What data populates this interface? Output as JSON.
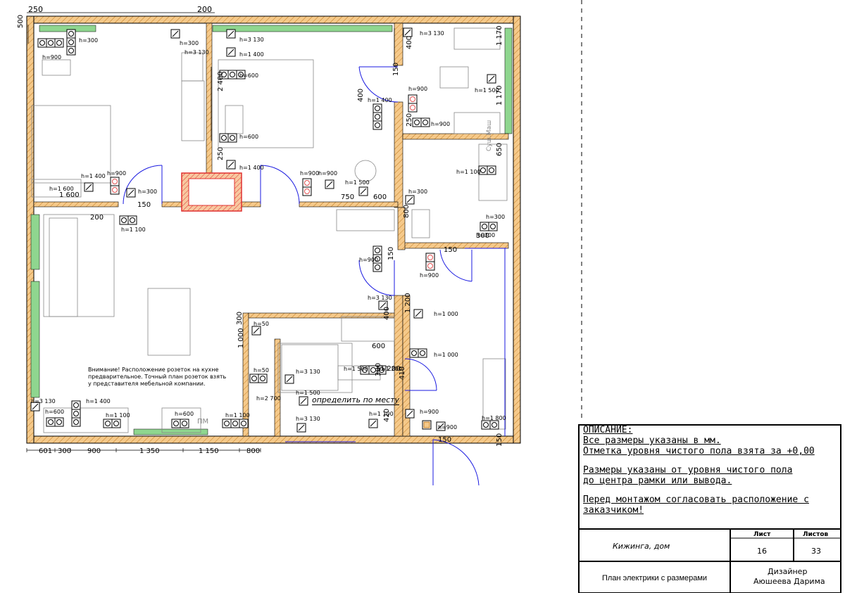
{
  "top_dims": [
    "250",
    "200"
  ],
  "bottom_dims": [
    "601",
    "300",
    "900",
    "1 350",
    "1 150",
    "800"
  ],
  "left_dims": [
    "500"
  ],
  "room_dims": [
    "2 400",
    "400",
    "400",
    "150",
    "250",
    "250",
    "1 170",
    "1 170",
    "650",
    "800",
    "150",
    "300",
    "150",
    "1 200",
    "400",
    "300",
    "1 000",
    "300",
    "410",
    "420",
    "150",
    "150",
    "1 600",
    "200",
    "150",
    "750",
    "600",
    "600",
    "1 200"
  ],
  "heights": [
    "h=300",
    "h=900",
    "h=300",
    "h=3 130",
    "h=3 130",
    "h=1 400",
    "h=600",
    "h=600",
    "h=1 400",
    "h=3 130",
    "h=900",
    "h=1 500",
    "h=1 400",
    "h=900",
    "h=1 100",
    "h=300",
    "h=300",
    "h=1 400",
    "h=900",
    "h=1 600",
    "h=300",
    "h=1 100",
    "h=900",
    "h=900",
    "h=1 500",
    "h=300",
    "h=900",
    "h=900",
    "h=3 130",
    "h=1 000",
    "h=1 000",
    "h=50",
    "h=50",
    "h=3 130",
    "h=2 700",
    "h=1 500",
    "h=1 500",
    "h=1 200",
    "h=3 130",
    "h=3 130",
    "h=1 100",
    "h=900",
    "h=900",
    "h=600",
    "h=1 400",
    "h=1 100",
    "h=600",
    "h=1 100",
    "h=1 800"
  ],
  "kitchen_note": [
    "Внимание! Расположение розеток на кухне",
    "предварительное. Точный план розеток взять",
    "у представителя мебельной компании."
  ],
  "determine_label": "определить по месту",
  "pm_label": "ПМ",
  "dryer_label": "Суш.Маш",
  "description": {
    "title": "ОПИСАНИЕ:",
    "lines": [
      "Все размеры указаны в мм.",
      "Отметка уровня чистого пола взята за +0,00",
      "",
      "Размеры указаны от уровня чистого пола",
      "до центра рамки или вывода.",
      "",
      "Перед монтажом согласовать расположение с",
      "заказчиком!"
    ]
  },
  "title_block": {
    "sheet_label": "Лист",
    "sheets_label": "Листов",
    "project": "Кижинга, дом",
    "sheet": "16",
    "sheets": "33",
    "drawing_title": "План электрики с размерами",
    "role": "Дизайнер",
    "author": "Аюшеева Дарима"
  },
  "colors": {
    "wall": "#f2c27a",
    "hatch": "#c07a20",
    "window": "#8fd68f",
    "socket_red": "#e05050",
    "blue": "#1a1ae0"
  }
}
